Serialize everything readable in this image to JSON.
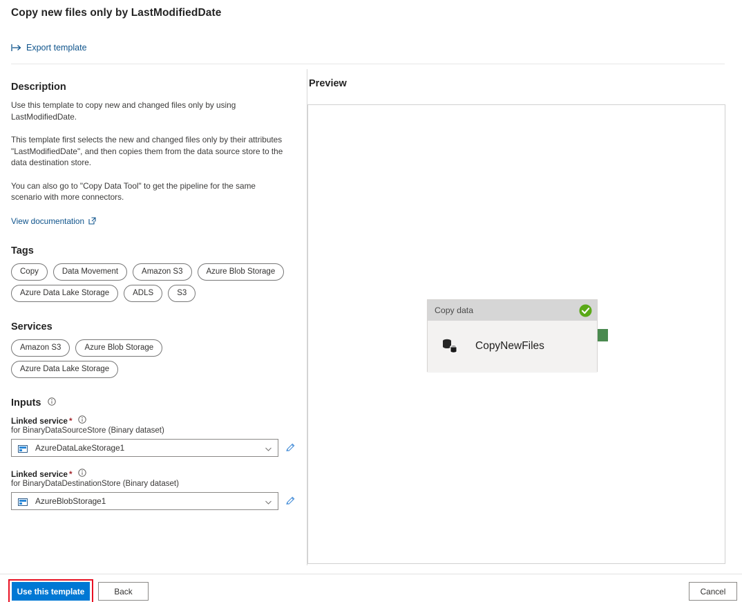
{
  "header": {
    "title": "Copy new files only by LastModifiedDate"
  },
  "command_bar": {
    "export_label": "Export template",
    "export_icon": "export-arrow-icon",
    "link_color": "#0f548c"
  },
  "description": {
    "heading": "Description",
    "paragraphs": [
      "Use this template to copy new and changed files only by using LastModifiedDate.",
      "This template first selects the new and changed files only by their attributes \"LastModifiedDate\", and then copies them from the data source store to the data destination store.",
      "You can also go to \"Copy Data Tool\" to get the pipeline for the same scenario with more connectors."
    ],
    "doc_link_label": "View documentation",
    "doc_link_icon": "external-link-icon"
  },
  "tags": {
    "heading": "Tags",
    "items": [
      "Copy",
      "Data Movement",
      "Amazon S3",
      "Azure Blob Storage",
      "Azure Data Lake Storage",
      "ADLS",
      "S3"
    ]
  },
  "services": {
    "heading": "Services",
    "items": [
      "Amazon S3",
      "Azure Blob Storage",
      "Azure Data Lake Storage"
    ]
  },
  "inputs": {
    "heading": "Inputs",
    "heading_info_icon": "info-icon",
    "fields": [
      {
        "label": "Linked service",
        "required_marker": "*",
        "info_icon": "info-icon",
        "sublabel": "for BinaryDataSourceStore (Binary dataset)",
        "value": "AzureDataLakeStorage1",
        "value_icon": "linked-service-icon",
        "chevron_icon": "chevron-down-icon",
        "edit_icon": "pencil-icon"
      },
      {
        "label": "Linked service",
        "required_marker": "*",
        "info_icon": "info-icon",
        "sublabel": "for BinaryDataDestinationStore (Binary dataset)",
        "value": "AzureBlobStorage1",
        "value_icon": "linked-service-icon",
        "chevron_icon": "chevron-down-icon",
        "edit_icon": "pencil-icon"
      }
    ]
  },
  "preview": {
    "label": "Preview",
    "activity": {
      "type_label": "Copy data",
      "name": "CopyNewFiles",
      "status_icon": "green-check-icon",
      "activity_icon": "copy-data-icon",
      "status_color": "#55a51c",
      "handle_color": "#4a8a4f",
      "header_bg": "#d6d6d6",
      "body_bg": "#f3f2f1"
    }
  },
  "footer": {
    "use_template_label": "Use this template",
    "back_label": "Back",
    "cancel_label": "Cancel",
    "primary_color": "#0078d4",
    "highlight_color": "#e81123"
  }
}
